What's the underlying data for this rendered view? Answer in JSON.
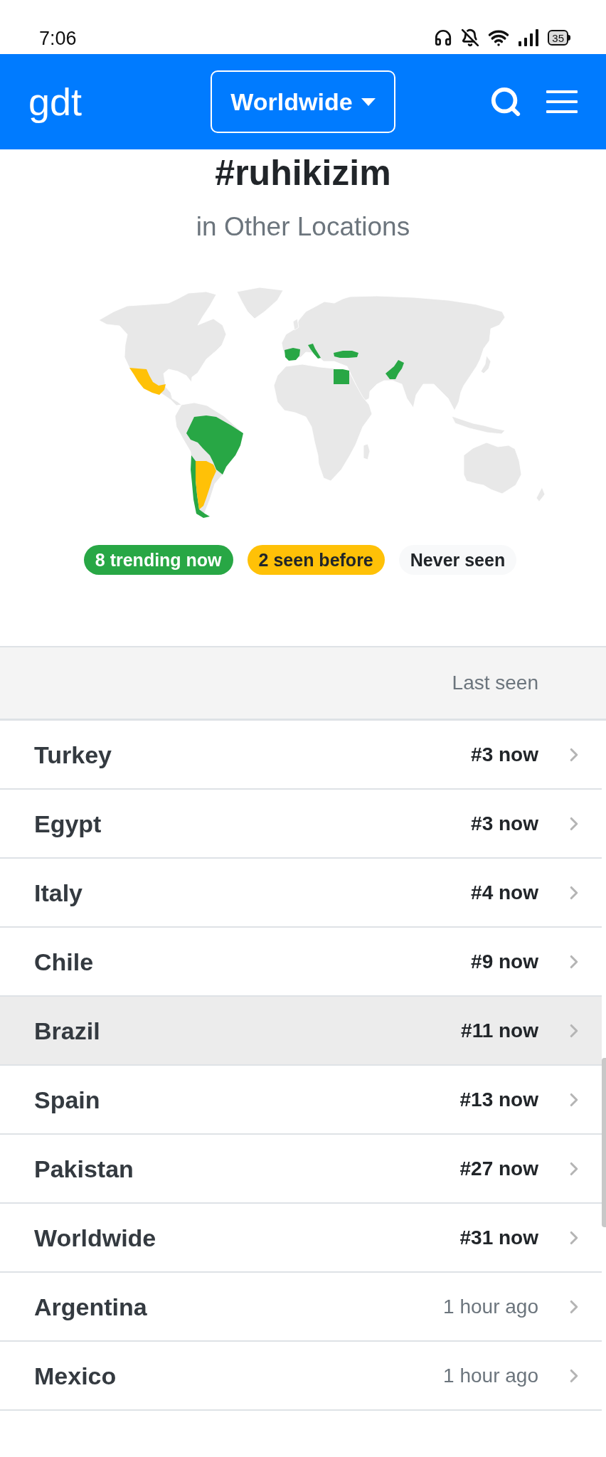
{
  "status_bar": {
    "time": "7:06",
    "battery": "35"
  },
  "header": {
    "logo": "g**dt**",
    "location_button": "Worldwide"
  },
  "title": "#ruhikizim",
  "subtitle": "in Other Locations",
  "legend": [
    {
      "label": "8 trending now",
      "kind": "trending",
      "color": "#28a745"
    },
    {
      "label": "2 seen before",
      "kind": "seen",
      "color": "#ffc107"
    },
    {
      "label": "Never seen",
      "kind": "never",
      "color": "#f8f9fa"
    }
  ],
  "table": {
    "header": "Last seen",
    "rows": [
      {
        "name": "Turkey",
        "last_seen": "#3 now",
        "kind": "trending",
        "highlighted": false
      },
      {
        "name": "Egypt",
        "last_seen": "#3 now",
        "kind": "trending",
        "highlighted": false
      },
      {
        "name": "Italy",
        "last_seen": "#4 now",
        "kind": "trending",
        "highlighted": false
      },
      {
        "name": "Chile",
        "last_seen": "#9 now",
        "kind": "trending",
        "highlighted": false
      },
      {
        "name": "Brazil",
        "last_seen": "#11 now",
        "kind": "trending",
        "highlighted": true
      },
      {
        "name": "Spain",
        "last_seen": "#13 now",
        "kind": "trending",
        "highlighted": false
      },
      {
        "name": "Pakistan",
        "last_seen": "#27 now",
        "kind": "trending",
        "highlighted": false
      },
      {
        "name": "Worldwide",
        "last_seen": "#31 now",
        "kind": "trending",
        "highlighted": false
      },
      {
        "name": "Argentina",
        "last_seen": "1 hour ago",
        "kind": "seen",
        "highlighted": false
      },
      {
        "name": "Mexico",
        "last_seen": "1 hour ago",
        "kind": "seen",
        "highlighted": false
      }
    ]
  }
}
